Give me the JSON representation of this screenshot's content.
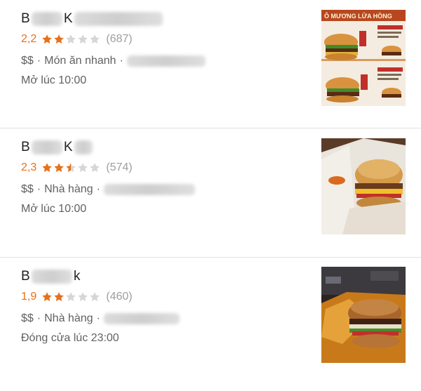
{
  "results": [
    {
      "name_visible": "B",
      "name_visible2": "K",
      "rating": "2,2",
      "stars": [
        1,
        1,
        0,
        0,
        0
      ],
      "reviews": "(687)",
      "price": "$$",
      "category": "Món ăn nhanh",
      "hours": "Mở lúc 10:00",
      "thumb_text_banner": "Ô MƯƠNG LỬA HỒNG",
      "thumb_icon": "burger-menu-photo"
    },
    {
      "name_visible": "B",
      "name_visible2": "K",
      "rating": "2,3",
      "stars": [
        1,
        1,
        0.5,
        0,
        0
      ],
      "reviews": "(574)",
      "price": "$$",
      "category": "Nhà hàng",
      "hours": "Mở lúc 10:00",
      "thumb_icon": "burger-photo"
    },
    {
      "name_visible": "B",
      "name_visible2": "k",
      "rating": "1,9",
      "stars": [
        1,
        1,
        0,
        0,
        0
      ],
      "reviews": "(460)",
      "price": "$$",
      "category": "Nhà hàng",
      "hours": "Đóng cửa lúc 23:00",
      "thumb_icon": "burger-photo"
    }
  ],
  "colors": {
    "rating": "#e7711b",
    "star_empty": "#d6d6d6",
    "text_secondary": "#616161",
    "reviews": "#9e9e9e",
    "divider": "#e0e0e0"
  }
}
